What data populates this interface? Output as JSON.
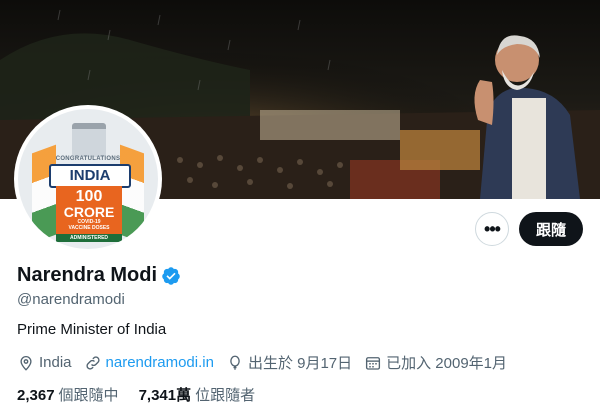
{
  "banner": {
    "description_icon": "banner-photo"
  },
  "avatar": {
    "congrats": "CONGRATULATIONS",
    "india": "INDIA",
    "big_number": "100",
    "crore": "CRORE",
    "sub1": "COVID-19",
    "sub2": "VACCINE DOSES",
    "administered": "ADMINISTERED"
  },
  "actions": {
    "more_label": "•••",
    "follow_label": "跟隨"
  },
  "profile": {
    "name": "Narendra Modi",
    "handle": "@narendramodi",
    "bio": "Prime Minister of India",
    "location": "India",
    "website": "narendramodi.in",
    "birthday": "出生於 9月17日",
    "joined": "已加入 2009年1月"
  },
  "stats": {
    "following_count": "2,367",
    "following_label": "個跟隨中",
    "followers_count": "7,341萬",
    "followers_label": "位跟隨者"
  },
  "colors": {
    "accent": "#1d9bf0",
    "text": "#0f1419",
    "muted": "#536471"
  }
}
